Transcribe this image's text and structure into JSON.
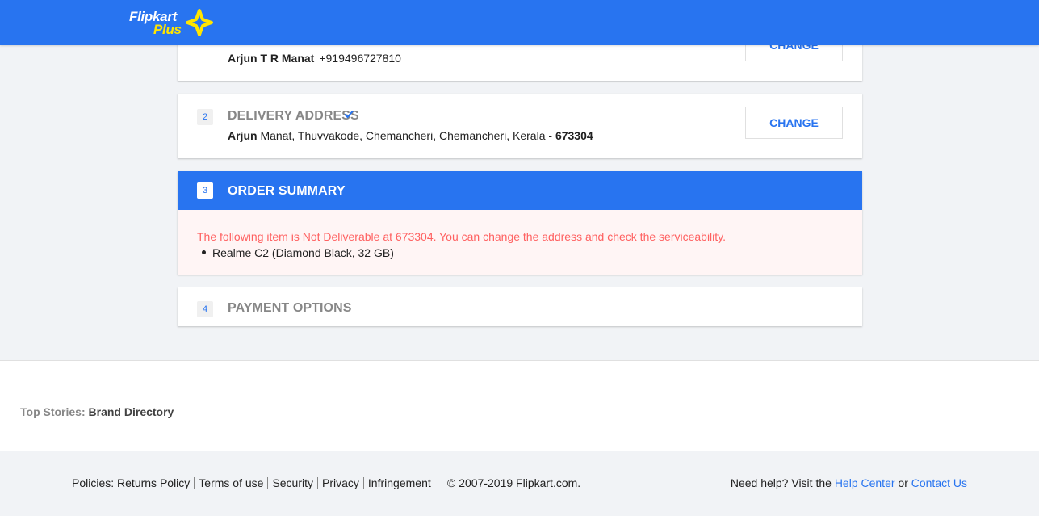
{
  "brand": {
    "logo_word": "Flipkart",
    "logo_plus": "Plus",
    "primary_color": "#2874f0",
    "accent_color": "#ffe500"
  },
  "login_step": {
    "name": "Arjun T R Manat",
    "phone": "+919496727810",
    "change_label": "CHANGE"
  },
  "address_step": {
    "number": "2",
    "title": "DELIVERY ADDRESS",
    "name": "Arjun",
    "address": " Manat, Thuvvakode, Chemancheri, Chemancheri, Kerala - ",
    "pincode": "673304",
    "change_label": "CHANGE"
  },
  "summary_step": {
    "number": "3",
    "title": "ORDER SUMMARY",
    "warning": "The following item is Not Deliverable at 673304. You can change the address and check the serviceability.",
    "item": "Realme C2 (Diamond Black, 32 GB)",
    "warning_color": "#ff6161"
  },
  "payment_step": {
    "number": "4",
    "title": "PAYMENT OPTIONS"
  },
  "top_stories": {
    "label": "Top Stories:",
    "link": "Brand Directory"
  },
  "footer": {
    "policies_label": "Policies:",
    "links": [
      "Returns Policy",
      "Terms of use",
      "Security",
      "Privacy",
      "Infringement"
    ],
    "copyright": "© 2007-2019 Flipkart.com.",
    "help_prefix": "Need help? Visit the ",
    "help_center": "Help Center",
    "help_or": " or ",
    "contact_us": "Contact Us"
  }
}
